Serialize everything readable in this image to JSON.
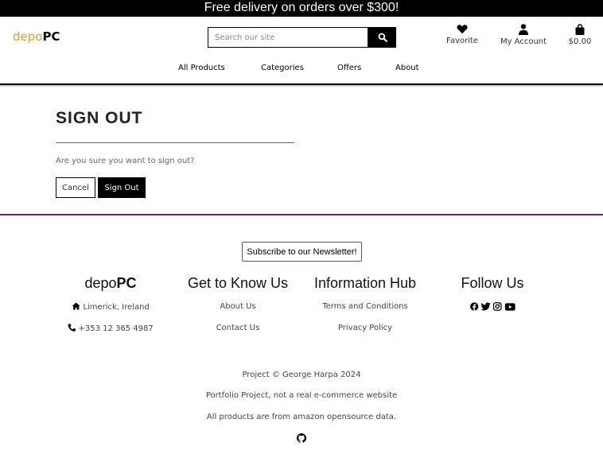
{
  "banner": {
    "text": "Free delivery on orders over $300!"
  },
  "brand": {
    "part1": "depo",
    "part2": "PC"
  },
  "search": {
    "placeholder": "Search our site"
  },
  "header_links": {
    "favorite": "Favorite",
    "account": "My Account",
    "bag_total": "$0.00"
  },
  "nav": {
    "items": [
      "All Products",
      "Categories",
      "Offers",
      "About"
    ]
  },
  "main": {
    "title": "SIGN OUT",
    "message": "Are you sure you want to sign out?",
    "cancel_label": "Cancel",
    "signout_label": "Sign Out"
  },
  "footer": {
    "newsletter_label": "Subscribe to our Newsletter!",
    "brand": {
      "part1": "depo",
      "part2": "PC"
    },
    "location": "Limerick, Ireland",
    "phone": "+353 12 365 4987",
    "know_us": {
      "title": "Get to Know Us",
      "links": [
        "About Us",
        "Contact Us"
      ]
    },
    "info_hub": {
      "title": "Information Hub",
      "links": [
        "Terms and Conditions",
        "Privacy Policy"
      ]
    },
    "follow": {
      "title": "Follow Us",
      "icons": [
        "facebook-icon",
        "twitter-icon",
        "instagram-icon",
        "youtube-icon"
      ]
    },
    "copyright": "Project © George Harpa 2024",
    "disclaimer": "Portfolio Project, not a real e-commerce website",
    "data_note": "All products are from amazon opensource data."
  },
  "colors": {
    "accent_gold": "#c9a24c",
    "divider_purple": "#6a1b8a",
    "banner_bg": "#000000"
  }
}
